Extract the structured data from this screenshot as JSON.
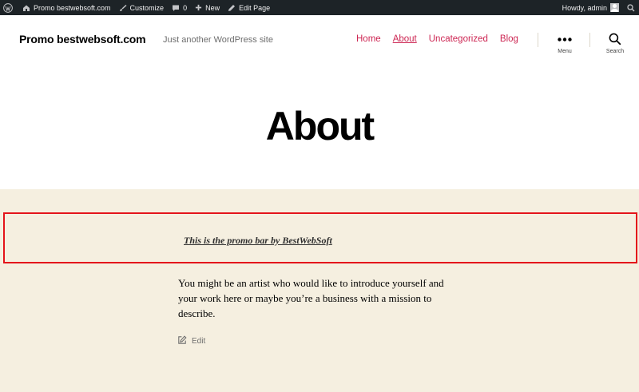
{
  "adminbar": {
    "site_name": "Promo bestwebsoft.com",
    "customize": "Customize",
    "comments_count": "0",
    "new_label": "New",
    "edit_page": "Edit Page",
    "howdy": "Howdy, admin"
  },
  "header": {
    "site_title": "Promo bestwebsoft.com",
    "site_description": "Just another WordPress site",
    "nav": [
      "Home",
      "About",
      "Uncategorized",
      "Blog"
    ],
    "current_nav": "About",
    "menu_label": "Menu",
    "search_label": "Search"
  },
  "page": {
    "title": "About"
  },
  "promo": {
    "text": "This is the promo bar by BestWebSoft"
  },
  "content": {
    "paragraph": "You might be an artist who would like to introduce yourself and your work here or maybe you’re a business with a mission to describe.",
    "edit_label": "Edit"
  },
  "colors": {
    "accent": "#cd2653",
    "background": "#f5efe0",
    "adminbar": "#1d2327",
    "promo_border": "#e4141b"
  },
  "icons": [
    "wordpress-icon",
    "home-icon",
    "brush-icon",
    "comment-icon",
    "plus-icon",
    "pencil-icon",
    "avatar",
    "ellipsis-icon",
    "search-icon",
    "edit-icon"
  ]
}
